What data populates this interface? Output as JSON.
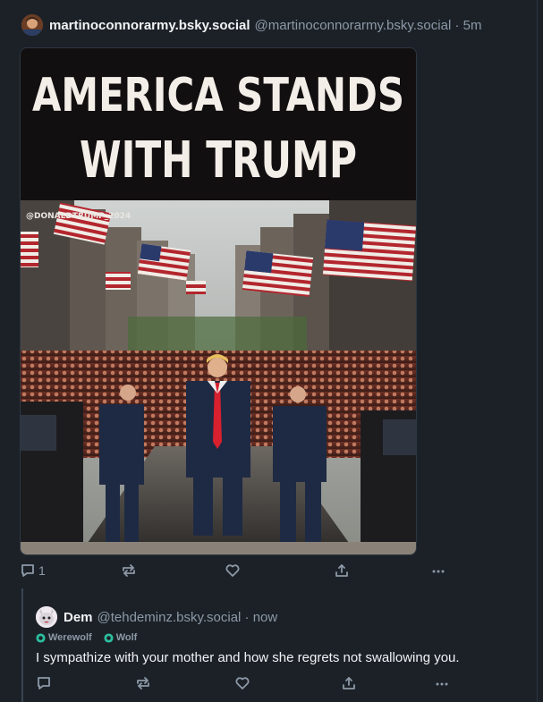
{
  "post": {
    "display_name": "martinoconnorarmy.bsky.social",
    "handle_time": "@martinoconnorarmy.bsky.social · 5m",
    "media": {
      "headline_line1": "AMERICA STANDS",
      "headline_line2": "WITH TRUMP",
      "watermark": "@DONALDTRUMP_2024"
    },
    "reply_count": "1"
  },
  "reply": {
    "display_name": "Dem",
    "handle_time": "@tehdeminz.bsky.social · now",
    "labels": [
      "Werewolf",
      "Wolf"
    ],
    "text": "I sympathize with your mother and how she regrets not swallowing you."
  },
  "icons": [
    "reply-icon",
    "repost-icon",
    "like-icon",
    "share-icon",
    "more-icon",
    "label-badge-icon"
  ],
  "colors": {
    "background": "#1c2128",
    "text_primary": "#f1f3f5",
    "text_secondary": "#8c99a6",
    "border": "#2e3640",
    "thread_line": "#3a4452"
  }
}
